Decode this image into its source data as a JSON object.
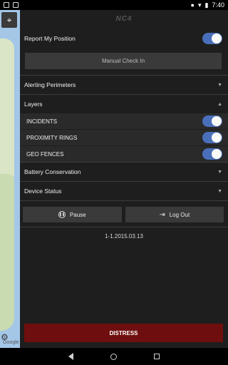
{
  "status_bar": {
    "time": "7:40"
  },
  "map": {
    "attribution": "Google"
  },
  "panel": {
    "logo": "NC4",
    "report_position": {
      "label": "Report My Position",
      "on": true
    },
    "manual_check_in": "Manual Check In",
    "sections": {
      "alerting_perimeters": "Alerting Perimeters",
      "layers": "Layers",
      "battery_conservation": "Battery Conservation",
      "device_status": "Device Status"
    },
    "layers": [
      {
        "label": "INCIDENTS",
        "on": true
      },
      {
        "label": "PROXIMITY RINGS",
        "on": true
      },
      {
        "label": "GEO FENCES",
        "on": true
      }
    ],
    "actions": {
      "pause": "Pause",
      "logout": "Log Out"
    },
    "version": "1-1.2015.03.13",
    "distress": "DISTRESS"
  },
  "colors": {
    "toggle_on": "#4a6fba",
    "distress": "#6e0e0e"
  }
}
